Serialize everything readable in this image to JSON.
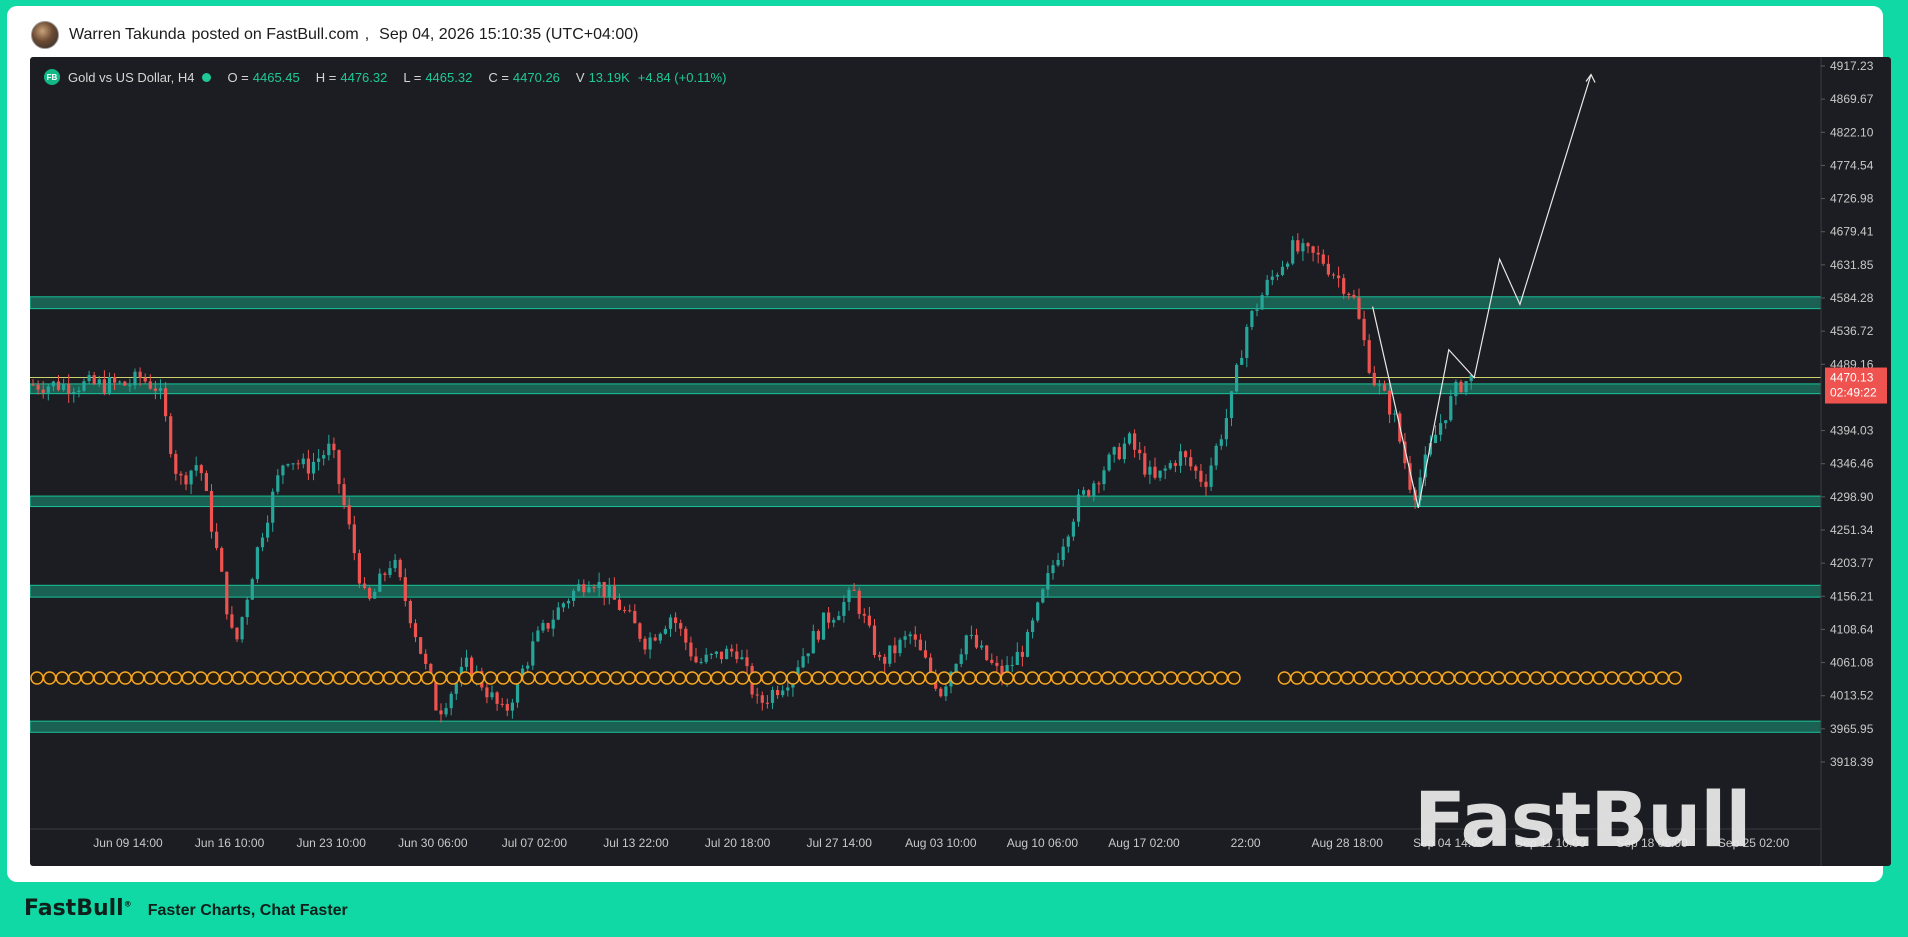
{
  "post": {
    "author": "Warren Takunda",
    "action": "posted on FastBull.com",
    "separator": ",",
    "datetime": "Sep 04, 2026 15:10:35 (UTC+04:00)"
  },
  "legend": {
    "logo": "FB",
    "symbol": "Gold vs US Dollar, H4",
    "open_label": "O =",
    "open": "4465.45",
    "high_label": "H =",
    "high": "4476.32",
    "low_label": "L =",
    "low": "4465.32",
    "close_label": "C =",
    "close": "4470.26",
    "volume_label": "V",
    "volume": "13.19K",
    "change": "+4.84 (+0.11%)"
  },
  "price_axis": {
    "labels": [
      "4917.23",
      "4869.67",
      "4822.10",
      "4774.54",
      "4726.98",
      "4679.41",
      "4631.85",
      "4584.28",
      "4536.72",
      "4489.16",
      "4394.03",
      "4346.46",
      "4298.90",
      "4251.34",
      "4203.77",
      "4156.21",
      "4108.64",
      "4061.08",
      "4013.52",
      "3965.95",
      "3918.39"
    ],
    "current_price": "4470.13",
    "countdown": "02:49:22"
  },
  "time_axis": {
    "labels": [
      "Jun 09 14:00",
      "Jun 16 10:00",
      "Jun 23 10:00",
      "Jun 30 06:00",
      "Jul 07 02:00",
      "Jul 13 22:00",
      "Jul 20 18:00",
      "Jul 27 14:00",
      "Aug 03 10:00",
      "Aug 10 06:00",
      "Aug 17 02:00",
      "22:00",
      "Aug 28 18:00",
      "Sep 04 14:00",
      "Sep 11 10:00",
      "Sep 18 06:00",
      "Sep 25 02:00"
    ]
  },
  "colors": {
    "background": "#1c1d22",
    "up": "#26a69a",
    "down": "#ef5350",
    "zone": "#18c29a",
    "price_tag": "#ef5350",
    "event_marker": "#f5a623"
  },
  "watermark": "FastBull",
  "footer": {
    "logo": "FastBull",
    "tagline": "Faster Charts, Chat Faster"
  },
  "chart_data": {
    "type": "candlestick",
    "title": "Gold vs US Dollar, H4",
    "ylim": [
      3895,
      4930
    ],
    "y_ticks": [
      4917.23,
      4869.67,
      4822.1,
      4774.54,
      4726.98,
      4679.41,
      4631.85,
      4584.28,
      4536.72,
      4489.16,
      4394.03,
      4346.46,
      4298.9,
      4251.34,
      4203.77,
      4156.21,
      4108.64,
      4061.08,
      4013.52,
      3965.95,
      3918.39
    ],
    "x_categories": [
      "Jun 09 14:00",
      "Jun 16 10:00",
      "Jun 23 10:00",
      "Jun 30 06:00",
      "Jul 07 02:00",
      "Jul 13 22:00",
      "Jul 20 18:00",
      "Jul 27 14:00",
      "Aug 03 10:00",
      "Aug 10 06:00",
      "Aug 17 02:00",
      "22:00",
      "Aug 28 18:00",
      "Sep 04 14:00",
      "Sep 11 10:00",
      "Sep 18 06:00",
      "Sep 25 02:00"
    ],
    "price_path": [
      [
        0,
        4460
      ],
      [
        0.12,
        4470
      ],
      [
        0.3,
        4455
      ],
      [
        0.5,
        4320
      ],
      [
        0.7,
        4350
      ],
      [
        0.9,
        4200
      ],
      [
        1.05,
        4080
      ],
      [
        1.3,
        4240
      ],
      [
        1.55,
        4360
      ],
      [
        1.75,
        4340
      ],
      [
        2.0,
        4370
      ],
      [
        2.15,
        4270
      ],
      [
        2.35,
        4140
      ],
      [
        2.6,
        4210
      ],
      [
        2.8,
        4120
      ],
      [
        3.05,
        3990
      ],
      [
        3.35,
        4060
      ],
      [
        3.7,
        3985
      ],
      [
        4.0,
        4090
      ],
      [
        4.3,
        4150
      ],
      [
        4.55,
        4185
      ],
      [
        4.85,
        4140
      ],
      [
        5.1,
        4090
      ],
      [
        5.35,
        4130
      ],
      [
        5.6,
        4060
      ],
      [
        6.0,
        4080
      ],
      [
        6.2,
        4000
      ],
      [
        6.5,
        4040
      ],
      [
        6.85,
        4120
      ],
      [
        7.15,
        4160
      ],
      [
        7.4,
        4060
      ],
      [
        7.7,
        4100
      ],
      [
        8.0,
        4020
      ],
      [
        8.25,
        4100
      ],
      [
        8.6,
        4040
      ],
      [
        8.85,
        4090
      ],
      [
        9.1,
        4200
      ],
      [
        9.35,
        4290
      ],
      [
        9.6,
        4340
      ],
      [
        9.85,
        4380
      ],
      [
        10.1,
        4320
      ],
      [
        10.35,
        4360
      ],
      [
        10.6,
        4320
      ],
      [
        10.85,
        4430
      ],
      [
        11.0,
        4540
      ],
      [
        11.2,
        4600
      ],
      [
        11.45,
        4655
      ],
      [
        11.75,
        4640
      ],
      [
        12.05,
        4590
      ],
      [
        12.25,
        4470
      ],
      [
        12.45,
        4420
      ],
      [
        12.65,
        4300
      ],
      [
        12.9,
        4400
      ],
      [
        13.1,
        4460
      ],
      [
        13.25,
        4470
      ]
    ],
    "support_resistance_zones": [
      [
        4569,
        4586
      ],
      [
        4447,
        4461
      ],
      [
        4285,
        4300
      ],
      [
        4155,
        4172
      ],
      [
        3961,
        3977
      ]
    ],
    "horizontal_line": 4470.13,
    "projection_path": [
      [
        12.25,
        4572
      ],
      [
        12.7,
        4283
      ],
      [
        13.0,
        4510
      ],
      [
        13.25,
        4470
      ],
      [
        13.5,
        4640
      ],
      [
        13.7,
        4575
      ],
      [
        14.4,
        4905
      ]
    ],
    "last_price": 4470.13
  }
}
